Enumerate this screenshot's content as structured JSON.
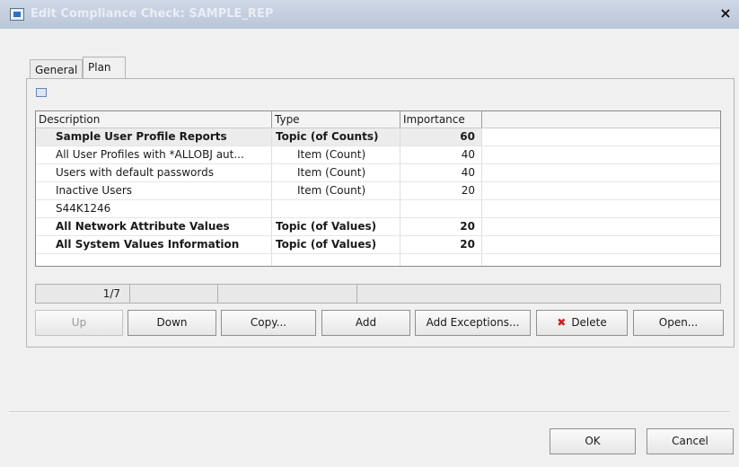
{
  "window": {
    "title": "Edit Compliance Check: SAMPLE_REP",
    "close_label": "×"
  },
  "tabs": [
    {
      "label": "General",
      "active": false
    },
    {
      "label": "Plan",
      "active": true
    }
  ],
  "grid": {
    "columns": [
      "Description",
      "Type",
      "Importance",
      ""
    ],
    "rows": [
      {
        "description": "Sample User Profile Reports",
        "type": "Topic (of Counts)",
        "importance": "60",
        "bold": true,
        "selected": true
      },
      {
        "description": "All User Profiles with *ALLOBJ aut...",
        "type": "Item (Count)",
        "importance": "40",
        "bold": false
      },
      {
        "description": "Users with default passwords",
        "type": "Item (Count)",
        "importance": "40",
        "bold": false
      },
      {
        "description": "Inactive Users",
        "type": "Item (Count)",
        "importance": "20",
        "bold": false
      },
      {
        "description": "S44K1246",
        "type": "",
        "importance": "",
        "bold": false
      },
      {
        "description": "All Network Attribute Values",
        "type": "Topic (of Values)",
        "importance": "20",
        "bold": true
      },
      {
        "description": "All System Values Information",
        "type": "Topic (of Values)",
        "importance": "20",
        "bold": true
      },
      {
        "description": "",
        "type": "",
        "importance": ""
      },
      {
        "description": "",
        "type": "",
        "importance": ""
      }
    ]
  },
  "status": {
    "position": "1/7"
  },
  "buttons": {
    "up": "Up",
    "down": "Down",
    "copy": "Copy...",
    "add": "Add",
    "add_exceptions": "Add Exceptions...",
    "delete": "Delete",
    "delete_icon": "✖",
    "open": "Open..."
  },
  "footer": {
    "ok": "OK",
    "cancel": "Cancel"
  },
  "colors": {
    "title_bar": "#b9c6d8",
    "delete_icon": "#d21e1e"
  }
}
